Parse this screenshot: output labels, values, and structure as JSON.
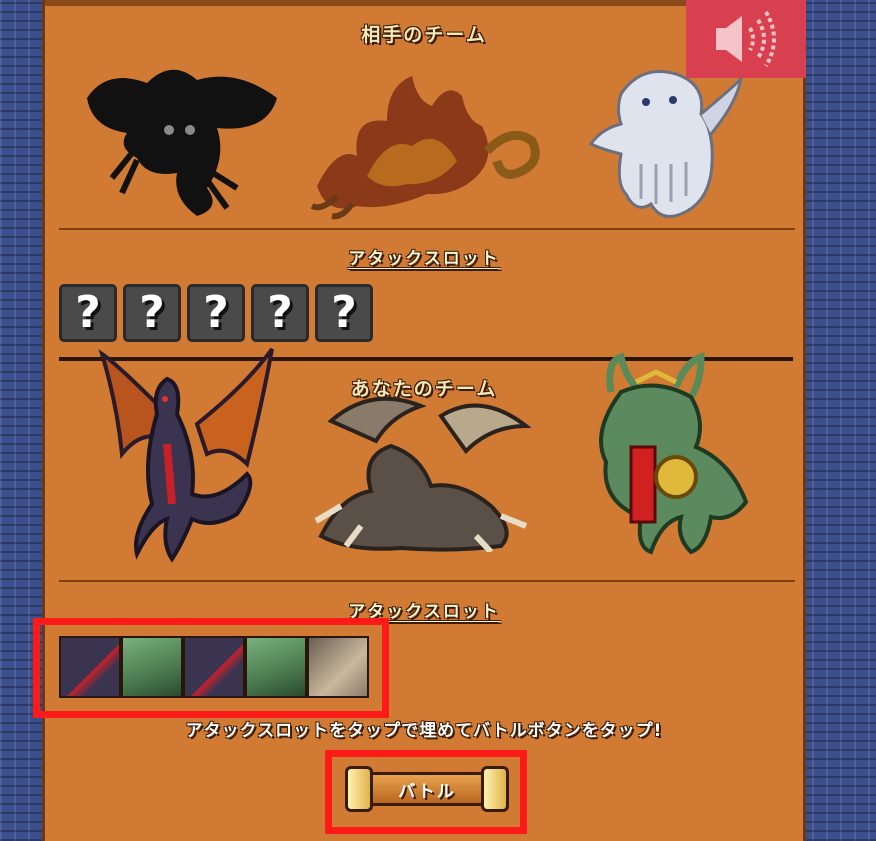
{
  "opponent_team": {
    "title": "相手のチーム",
    "monsters": [
      {
        "name": "shadow-monster",
        "kind": "silhouette"
      },
      {
        "name": "fire-monster",
        "kind": "flame"
      },
      {
        "name": "ghost-monster",
        "kind": "ghost"
      }
    ],
    "attack_slot_title": "アタックスロット",
    "slots": [
      "?",
      "?",
      "?",
      "?",
      "?"
    ]
  },
  "your_team": {
    "title": "あなたのチーム",
    "monsters": [
      {
        "name": "dark-dragon",
        "kind": "winged-dragon"
      },
      {
        "name": "bone-dragon",
        "kind": "spiked-dragon"
      },
      {
        "name": "green-dragon-warrior",
        "kind": "armored-dragon"
      }
    ],
    "attack_slot_title": "アタックスロット",
    "slots": [
      "dark-dragon",
      "green-dragon-warrior",
      "dark-dragon",
      "green-dragon-warrior",
      "bone-dragon"
    ]
  },
  "instruction": "アタックスロットをタップで埋めてバトルボタンをタップ!",
  "battle_button": "バトル",
  "sound_icon": "speaker-icon",
  "colors": {
    "panel": "#d07a34",
    "highlight": "#ff1a1a",
    "sound_button": "#d9404f"
  }
}
